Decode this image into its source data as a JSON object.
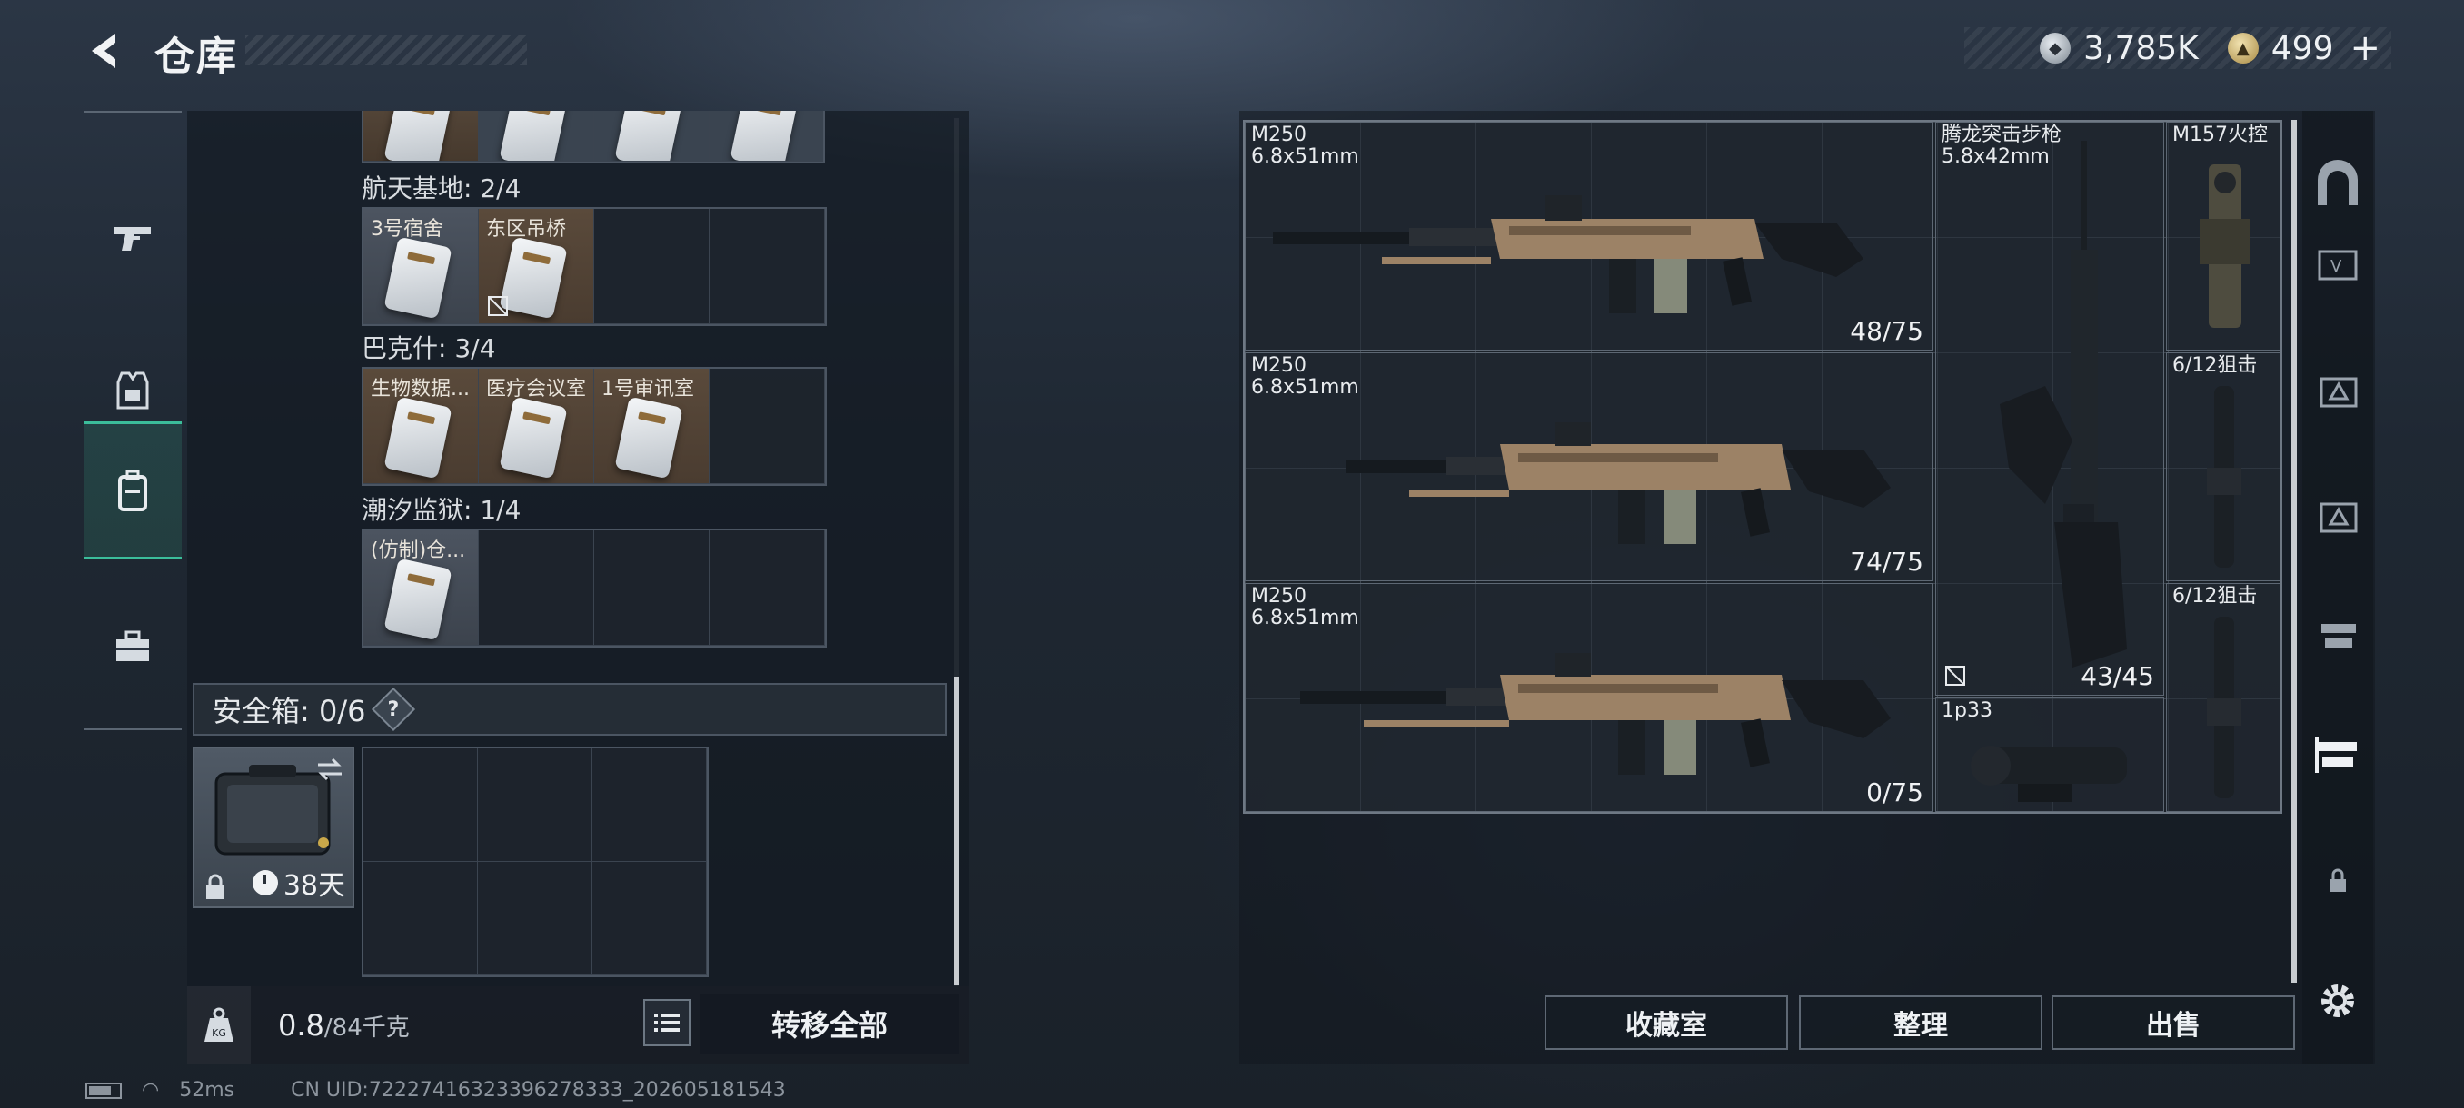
{
  "header": {
    "title": "仓库",
    "currency_main": "3,785K",
    "currency_premium": "499",
    "plus": "+"
  },
  "left_nav": {
    "items": [
      {
        "name": "weapons",
        "icon": "gun-icon"
      },
      {
        "name": "gear",
        "icon": "armor-vest-icon"
      },
      {
        "name": "backpack",
        "icon": "backpack-icon",
        "active": true
      },
      {
        "name": "supplies",
        "icon": "toolbox-icon"
      }
    ]
  },
  "storage": {
    "sections": [
      {
        "label": "航天基地: 2/4",
        "items": [
          "3号宿舍",
          "东区吊桥"
        ]
      },
      {
        "label": "巴克什: 3/4",
        "items": [
          "生物数据...",
          "医疗会议室",
          "1号审讯室"
        ]
      },
      {
        "label": "潮汐监狱: 1/4",
        "items": [
          "(仿制)仓..."
        ]
      }
    ],
    "safe_box_label": "安全箱: 0/6",
    "help": "?",
    "safe_box_days": "38天",
    "weight_current": "0.8",
    "weight_max": "/84千克",
    "transfer_all": "转移全部"
  },
  "inventory": {
    "items": [
      {
        "name": "M250",
        "caliber": "6.8x51mm",
        "count": "48/75"
      },
      {
        "name": "M250",
        "caliber": "6.8x51mm",
        "count": "74/75"
      },
      {
        "name": "M250",
        "caliber": "6.8x51mm",
        "count": "0/75"
      },
      {
        "name": "腾龙突击步枪",
        "caliber": "5.8x42mm",
        "count": "43/45"
      },
      {
        "name": "M157火控",
        "caliber": "",
        "count": ""
      },
      {
        "name": "6/12狙击",
        "caliber": "",
        "count": ""
      },
      {
        "name": "6/12狙击",
        "caliber": "",
        "count": ""
      },
      {
        "name": "1p33",
        "caliber": "",
        "count": ""
      }
    ],
    "buttons": {
      "collection": "收藏室",
      "organize": "整理",
      "sell": "出售"
    }
  },
  "status_bar": {
    "ping": "52ms",
    "uid": "CN UID:72227416323396278333_202605181543"
  }
}
